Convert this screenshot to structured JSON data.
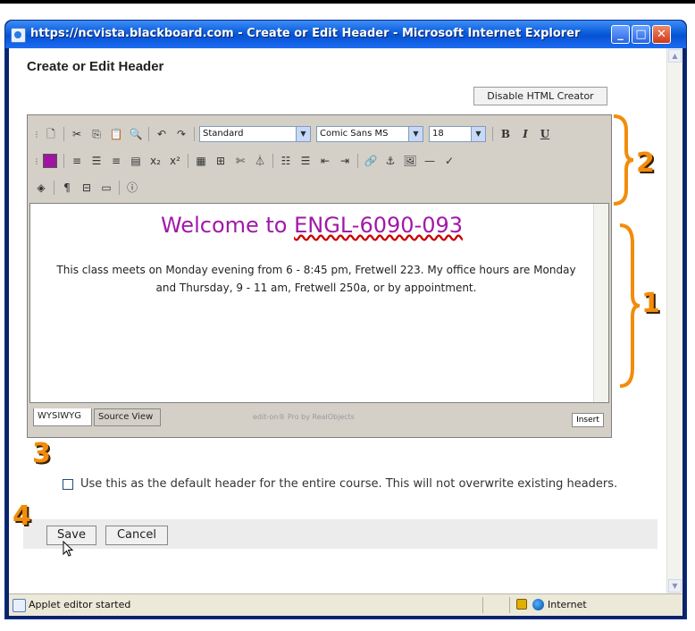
{
  "window": {
    "title": "https://ncvista.blackboard.com - Create or Edit Header - Microsoft Internet Explorer",
    "min": "_",
    "max": "□",
    "close": "✕"
  },
  "page": {
    "title": "Create or Edit Header",
    "disable_html_creator": "Disable HTML Creator"
  },
  "editor": {
    "toolbar": {
      "style_select": "Standard",
      "font_select": "Comic Sans MS",
      "size_select": "18",
      "bold": "B",
      "italic": "I",
      "underline": "U"
    },
    "content": {
      "heading_prefix": "Welcome to ",
      "heading_course": "ENGL-6090-093",
      "body": "This class meets on Monday evening from 6 - 8:45 pm, Fretwell 223. My office hours are Monday and Thursday, 9 - 11 am, Fretwell 250a, or by appointment."
    },
    "tabs": [
      "WYSIWYG",
      "Source View"
    ],
    "branding": "edit-on® Pro by RealObjects",
    "insert": "Insert",
    "heading_color": "#a019a8"
  },
  "annotations": [
    "1",
    "2",
    "3",
    "4"
  ],
  "default_header": {
    "label": "Use this as the default header for the entire course. This will not overwrite existing headers.",
    "checked": false
  },
  "buttons": {
    "save": "Save",
    "cancel": "Cancel"
  },
  "statusbar": {
    "text": "Applet editor started",
    "zone": "Internet"
  },
  "colors": {
    "accent_orange": "#f28c0a",
    "titlebar_blue": "#0a5ddb"
  }
}
